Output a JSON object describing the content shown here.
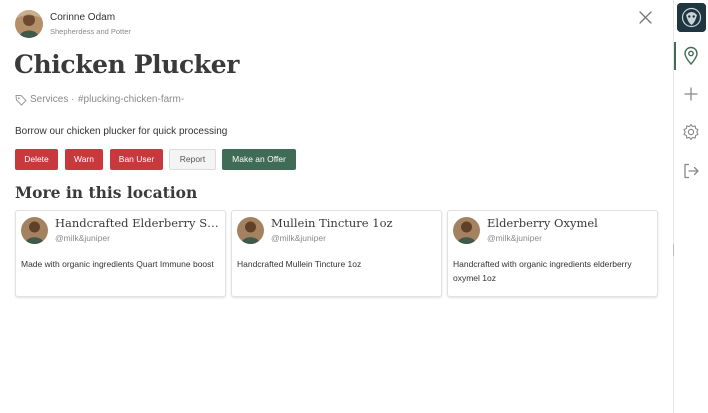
{
  "header": {
    "author_name": "Corinne Odam",
    "author_subtitle": "Shepherdess and Potter",
    "avatar_icon": "user-avatar-photo",
    "close_icon": "close-icon"
  },
  "listing": {
    "title": "Chicken Plucker",
    "tag_icon": "tag-icon",
    "category": "Services",
    "separator": "·",
    "hashtag": "#plucking-chicken-farm-",
    "description": "Borrow our chicken plucker for quick processing"
  },
  "actions": {
    "delete": "Delete",
    "warn": "Warn",
    "ban_user": "Ban User",
    "report": "Report",
    "make_offer": "Make an Offer"
  },
  "section": {
    "title": "More in this location"
  },
  "cards": [
    {
      "title": "Handcrafted Elderberry Syr...",
      "handle": "@milk&juniper",
      "body": "Made with organic ingredients Quart Immune boost"
    },
    {
      "title": "Mullein Tincture 1oz",
      "handle": "@milk&juniper",
      "body": "Handcrafted Mullein Tincture 1oz"
    },
    {
      "title": "Elderberry Oxymel",
      "handle": "@milk&juniper",
      "body": "Handcrafted with organic ingredients elderberry oxymel 1oz"
    }
  ],
  "rail": {
    "items": [
      "app-logo",
      "map-pin-icon",
      "plus-icon",
      "settings-gear-icon",
      "logout-icon"
    ],
    "active_item": "map-pin-icon"
  },
  "colors": {
    "danger": "#c9383d",
    "primary_green": "#3f6b57",
    "heading": "#3a3a3a",
    "muted": "#8a8a8a"
  }
}
